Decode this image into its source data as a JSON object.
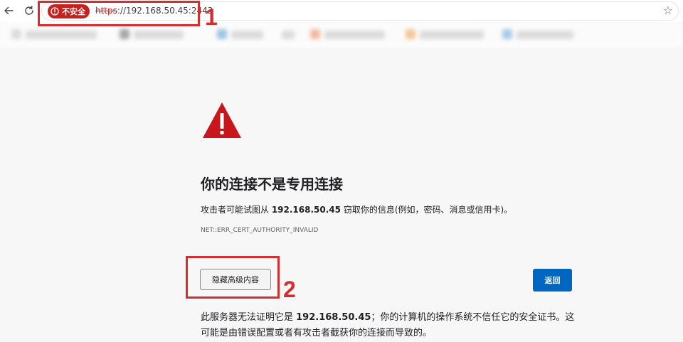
{
  "browser": {
    "security_label": "不安全",
    "url_scheme": "https",
    "url_rest": "://192.168.50.45:2443",
    "icons": {
      "back": "arrow-left-icon",
      "reload": "reload-icon",
      "security": "shield-warning-icon",
      "favorite": "star-outline-icon"
    }
  },
  "annotations": {
    "label_1": "1",
    "label_2": "2",
    "color": "#d32f2f"
  },
  "error_page": {
    "warning_icon": "warning-triangle-icon",
    "title": "你的连接不是专用连接",
    "desc_prefix": "攻击者可能试图从 ",
    "desc_host": "192.168.50.45",
    "desc_suffix": " 窃取你的信息(例如，密码、消息或信用卡)。",
    "error_code": "NET::ERR_CERT_AUTHORITY_INVALID",
    "hide_advanced_label": "隐藏高级内容",
    "back_label": "返回",
    "details_prefix": "此服务器无法证明它是 ",
    "details_host": "192.168.50.45",
    "details_suffix": "；你的计算机的操作系统不信任它的安全证书。这可能是由错误配置或者有攻击者截获你的连接而导致的。"
  },
  "colors": {
    "danger": "#c5221f",
    "primary_button": "#0067c0",
    "page_background": "#f7f7f7"
  }
}
